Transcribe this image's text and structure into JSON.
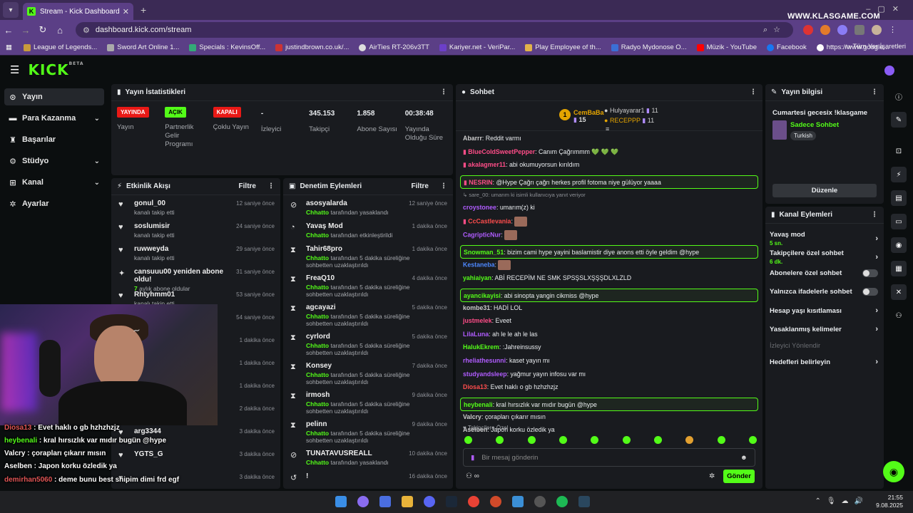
{
  "browser": {
    "tab_title": "Stream - Kick Dashboard",
    "url": "dashboard.kick.com/stream",
    "watermark": "WWW.KLASGAME.COM",
    "bookmarks": [
      "League of Legends...",
      "Sword Art Online 1...",
      "Specials : KevinsOff...",
      "justindbrown.co.uk/...",
      "AirTies RT-206v3TT",
      "Kariyer.net - VeriPar...",
      "Play Employee of th...",
      "Radyo Mydonose O...",
      "Müzik - YouTube",
      "Facebook",
      "https://www.google..."
    ],
    "bookmarks_all": "Tüm Yer İşaretleri"
  },
  "app": {
    "logo": "KICK",
    "logo_sup": "BETA"
  },
  "sidebar": {
    "items": [
      {
        "label": "Yayın",
        "icon": "play-icon"
      },
      {
        "label": "Para Kazanma",
        "icon": "money-icon"
      },
      {
        "label": "Başarılar",
        "icon": "trophy-icon"
      },
      {
        "label": "Stüdyo",
        "icon": "studio-icon"
      },
      {
        "label": "Kanal",
        "icon": "channel-icon"
      },
      {
        "label": "Ayarlar",
        "icon": "gear-icon"
      }
    ]
  },
  "stats": {
    "title": "Yayın İstatistikleri",
    "items": [
      {
        "badge": "YAYINDA",
        "label": "Yayın",
        "color": "#e91916"
      },
      {
        "badge": "AÇIK",
        "label": "Partnerlik Gelir Programı",
        "color": "#53fc18"
      },
      {
        "badge": "KAPALI",
        "label": "Çoklu Yayın",
        "color": "#e91916"
      },
      {
        "value": "-",
        "label": "İzleyici"
      },
      {
        "value": "345.153",
        "label": "Takipçi"
      },
      {
        "value": "1.858",
        "label": "Abone Sayısı"
      },
      {
        "value": "00:38:48",
        "label": "Yayında Olduğu Süre"
      }
    ]
  },
  "activity": {
    "title": "Etkinlik Akışı",
    "filter": "Filtre",
    "rows": [
      {
        "name": "gonul_00",
        "sub": "kanalı takip etti",
        "time": "12 saniye önce"
      },
      {
        "name": "soslumisir",
        "sub": "kanalı takip etti",
        "time": "24 saniye önce"
      },
      {
        "name": "ruwweyda",
        "sub": "kanalı takip etti",
        "time": "29 saniye önce"
      },
      {
        "name": "cansuuu00 yeniden abone oldu!",
        "sub_hl": "7",
        "sub": "aylık abone oldular",
        "time": "31 saniye önce"
      },
      {
        "name": "Rhtyhmm01",
        "sub": "kanalı takip etti",
        "time": "53 saniye önce"
      },
      {
        "name": "",
        "sub": "",
        "time": "54 saniye önce"
      },
      {
        "name": "",
        "sub": "",
        "time": "1 dakika önce"
      },
      {
        "name": "",
        "sub": "",
        "time": "1 dakika önce"
      },
      {
        "name": "",
        "sub": "",
        "time": "1 dakika önce"
      },
      {
        "name": "",
        "sub": "",
        "time": "2 dakika önce"
      },
      {
        "name": "arg3344",
        "sub": "",
        "time": "3 dakika önce"
      },
      {
        "name": "YGTS_G",
        "sub": "",
        "time": "3 dakika önce"
      },
      {
        "name": "",
        "sub": "",
        "time": "3 dakika önce"
      }
    ]
  },
  "moderation": {
    "title": "Denetim Eylemleri",
    "filter": "Filtre",
    "rows": [
      {
        "name": "asosyalarda",
        "actor": "Chhatto",
        "sub": "tarafından yasaklandı",
        "time": "12 saniye önce",
        "icon": "ban-icon"
      },
      {
        "name": "Yavaş Mod",
        "actor": "Chhatto",
        "sub": "tarafından etkinleştirildi",
        "time": "1 dakika önce",
        "icon": "slow-icon"
      },
      {
        "name": "Tahir68pro",
        "actor": "Chhatto",
        "sub": "tarafından 5 dakika süreliğine sohbetten uzaklaştırıldı",
        "time": "1 dakika önce",
        "icon": "hourglass-icon"
      },
      {
        "name": "FreaQ10",
        "actor": "Chhatto",
        "sub": "tarafından 5 dakika süreliğine sohbetten uzaklaştırıldı",
        "time": "4 dakika önce",
        "icon": "hourglass-icon"
      },
      {
        "name": "agcayazi",
        "actor": "Chhatto",
        "sub": "tarafından 5 dakika süreliğine sohbetten uzaklaştırıldı",
        "time": "5 dakika önce",
        "icon": "hourglass-icon"
      },
      {
        "name": "cyrlord",
        "actor": "Chhatto",
        "sub": "tarafından 5 dakika süreliğine sohbetten uzaklaştırıldı",
        "time": "5 dakika önce",
        "icon": "hourglass-icon"
      },
      {
        "name": "Konsey",
        "actor": "Chhatto",
        "sub": "tarafından 5 dakika süreliğine sohbetten uzaklaştırıldı",
        "time": "7 dakika önce",
        "icon": "hourglass-icon"
      },
      {
        "name": "irmosh",
        "actor": "Chhatto",
        "sub": "tarafından 5 dakika süreliğine sohbetten uzaklaştırıldı",
        "time": "9 dakika önce",
        "icon": "hourglass-icon"
      },
      {
        "name": "pelinn",
        "actor": "Chhatto",
        "sub": "tarafından 5 dakika süreliğine sohbetten uzaklaştırıldı",
        "time": "9 dakika önce",
        "icon": "hourglass-icon"
      },
      {
        "name": "TUNATAVUSREALL",
        "actor": "Chhatto",
        "sub": "tarafından yasaklandı",
        "time": "10 dakika önce",
        "icon": "ban-icon"
      },
      {
        "name": "!",
        "actor": "",
        "sub": "",
        "time": "16 dakika önce",
        "icon": "undo-icon"
      }
    ]
  },
  "overlay_chat": [
    {
      "user": "Diosa13",
      "text": "Evet haklı o gb hzhzhzjz",
      "color": "#e05555"
    },
    {
      "user": "heybenali",
      "text": "kral hırsızlık var mıdır bugün @hype",
      "color": "#53fc18"
    },
    {
      "user": "Valcry",
      "text": "çorapları çıkarır mısın",
      "color": "#ffffff"
    },
    {
      "user": "Aselben",
      "text": "Japon korku özledik ya",
      "color": "#ffffff"
    },
    {
      "user": "demirhan5060",
      "text": "deme bunu best shipim dimi frd egf",
      "color": "#e05555"
    }
  ],
  "chat": {
    "title": "Sohbet",
    "top1": {
      "name": "CemBaBa",
      "count": "15",
      "rank": "1"
    },
    "top2": {
      "name": "Hulyayarar1",
      "count": "11"
    },
    "top3": {
      "name": "RECEPPP",
      "count": "11"
    },
    "messages": [
      {
        "user": "Abarrr",
        "text": "Reddit varmı",
        "color": "#cccccc",
        "hl": false
      },
      {
        "user": "BlueColdSweetPepper",
        "text": "Canım Çağrımmm 💚 💚 💚",
        "color": "#ff4d88",
        "hl": false
      },
      {
        "user": "akalagmer11",
        "text": "abi okumuyorsun kırıldım",
        "color": "#ff4d88",
        "hl": false
      },
      {
        "user": "NESRIN",
        "text": "@Hype Çağrı çağrı herkes profil fotoma niye gülüyor yaaaa",
        "color": "#ff4d88",
        "hl": true
      },
      {
        "user": "",
        "text": "↳ sare_00: umarım ki isimli kullanıcıya yanıt veriyor",
        "color": "#8d9096",
        "hl": false
      },
      {
        "user": "croystonee",
        "text": "umarım(z) ki",
        "color": "#b05cff",
        "hl": false
      },
      {
        "user": "CcCastlevania",
        "text": "",
        "color": "#ff4d4d",
        "hl": false
      },
      {
        "user": "CagripticNur",
        "text": "",
        "color": "#b05cff",
        "hl": false
      },
      {
        "user": "Snowman_51",
        "text": "bizim cami hype yayini baslamistir diye anons etti öyle geldim @hype",
        "color": "#53fc18",
        "hl": true
      },
      {
        "user": "Kestaneba",
        "text": "",
        "color": "#4d88ff",
        "hl": false
      },
      {
        "user": "yahiaiyan",
        "text": "ABİ RECEPİM NE SMK SPSŞSLXŞŞŞDLXLZLD",
        "color": "#53fc18",
        "hl": false
      },
      {
        "user": "ayancikayisi",
        "text": "abi sinopta yangin cikmiss @hype",
        "color": "#53fc18",
        "hl": true
      },
      {
        "user": "kombe31",
        "text": "HADİ LOL",
        "color": "#cccccc",
        "hl": false
      },
      {
        "user": "justmelek",
        "text": "Eveet",
        "color": "#ff4d88",
        "hl": false
      },
      {
        "user": "LilaLuna",
        "text": "ah le le ah le las",
        "color": "#b05cff",
        "hl": false
      },
      {
        "user": "HalukEkrem",
        "text": ":Jahreinsussy",
        "color": "#53fc18",
        "hl": false
      },
      {
        "user": "rheliathesunni",
        "text": "kaset yayın mı",
        "color": "#b05cff",
        "hl": false
      },
      {
        "user": "studyandsleep",
        "text": "yağmur yayın infosu var mı",
        "color": "#b05cff",
        "hl": false
      },
      {
        "user": "Diosa13",
        "text": "Evet haklı o gb hzhzhzjz",
        "color": "#ff4d4d",
        "hl": false
      },
      {
        "user": "heybenali",
        "text": "kral hırsızlık var mıdır bugün @hype",
        "color": "#53fc18",
        "hl": true
      },
      {
        "user": "Valcry",
        "text": "çorapları çıkarır mısın",
        "color": "#cccccc",
        "hl": false
      },
      {
        "user": "Aselben",
        "text": "Japon korku özledik ya",
        "color": "#cccccc",
        "hl": false
      }
    ],
    "followers_only": "Takipçilere Özel",
    "placeholder": "Bir mesaj gönderin",
    "send": "Gönder"
  },
  "stream_info": {
    "title": "Yayın bilgisi",
    "stream_title": "Cumartesi gecesix !klasgame",
    "category": "Sadece Sohbet",
    "tag": "Turkish",
    "edit": "Düzenle"
  },
  "channel_actions": {
    "title": "Kanal Eylemleri",
    "items": [
      {
        "label": "Yavaş mod",
        "sub": "5 sn.",
        "type": "arrow"
      },
      {
        "label": "Takipçilere özel sohbet",
        "sub": "6 dk.",
        "type": "arrow"
      },
      {
        "label": "Abonelere özel sohbet",
        "sub": "",
        "type": "toggle"
      },
      {
        "label": "Yalnızca ifadelerle sohbet",
        "sub": "",
        "type": "toggle"
      },
      {
        "label": "Hesap yaşı kısıtlaması",
        "sub": "",
        "type": "arrow"
      },
      {
        "label": "Yasaklanmış kelimeler",
        "sub": "",
        "type": "arrow"
      },
      {
        "label": "İzleyici Yönlendir",
        "sub": "",
        "type": "disabled"
      },
      {
        "label": "Hedefleri belirleyin",
        "sub": "",
        "type": "arrow"
      }
    ]
  },
  "taskbar": {
    "time": "21:55",
    "date": "9.08.2025"
  }
}
